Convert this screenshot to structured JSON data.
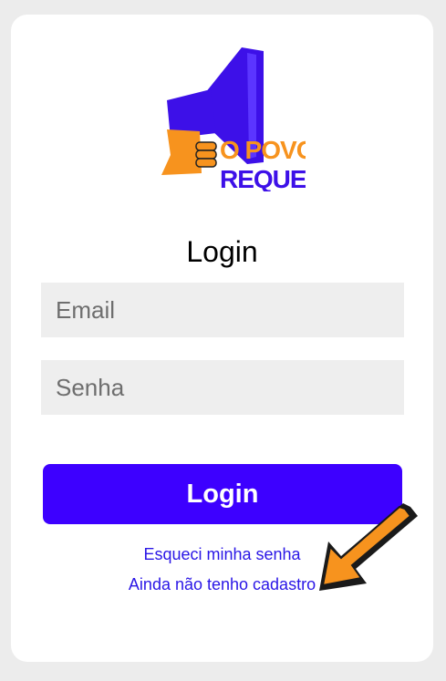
{
  "logo": {
    "line1": "O POVO",
    "line2": "REQUER",
    "icon": "megaphone-icon"
  },
  "login": {
    "title": "Login",
    "email_placeholder": "Email",
    "password_placeholder": "Senha",
    "button_label": "Login"
  },
  "links": {
    "forgot_password": "Esqueci minha senha",
    "register": "Ainda não tenho cadastro"
  },
  "pointer": {
    "icon": "arrow-icon"
  },
  "colors": {
    "background": "#ececec",
    "card": "#ffffff",
    "accent": "#3d00ff",
    "link": "#2a16e6",
    "input_bg": "#eeeeee",
    "logo_orange": "#f7931e",
    "arrow_orange": "#f7931e"
  }
}
